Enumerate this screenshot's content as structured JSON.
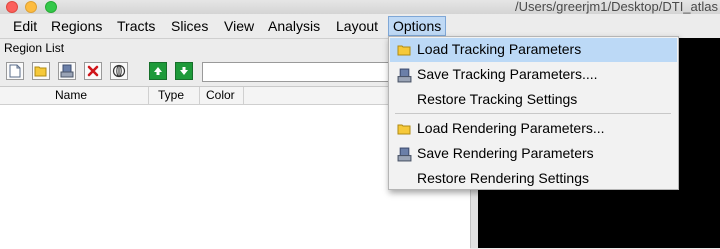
{
  "window": {
    "path": "/Users/greerjm1/Desktop/DTI_atlas"
  },
  "menubar": {
    "items": [
      {
        "label": "Edit"
      },
      {
        "label": "Regions"
      },
      {
        "label": "Tracts"
      },
      {
        "label": "Slices"
      },
      {
        "label": "View"
      },
      {
        "label": "Analysis"
      },
      {
        "label": "Layout"
      },
      {
        "label": "Options",
        "active": true
      }
    ]
  },
  "region_panel": {
    "title": "Region List",
    "toolbar": [
      "new-file-icon",
      "open-folder-icon",
      "save-icon",
      "delete-icon",
      "sphere-icon",
      "move-up-icon",
      "move-down-icon"
    ],
    "input_value": "",
    "columns": [
      "Name",
      "Type",
      "Color"
    ]
  },
  "options_menu": {
    "items": [
      {
        "label": "Load Tracking Parameters",
        "icon": "folder-icon",
        "selected": true
      },
      {
        "label": "Save Tracking Parameters....",
        "icon": "save-icon"
      },
      {
        "label": "Restore Tracking Settings",
        "icon": ""
      },
      {
        "label": "Load Rendering Parameters...",
        "icon": "folder-icon"
      },
      {
        "label": "Save Rendering Parameters",
        "icon": "save-icon"
      },
      {
        "label": "Restore Rendering Settings",
        "icon": ""
      }
    ]
  },
  "colors": {
    "selection": "#bcd9f6",
    "viewport": "#000000",
    "green_button": "#1e9a3a"
  }
}
